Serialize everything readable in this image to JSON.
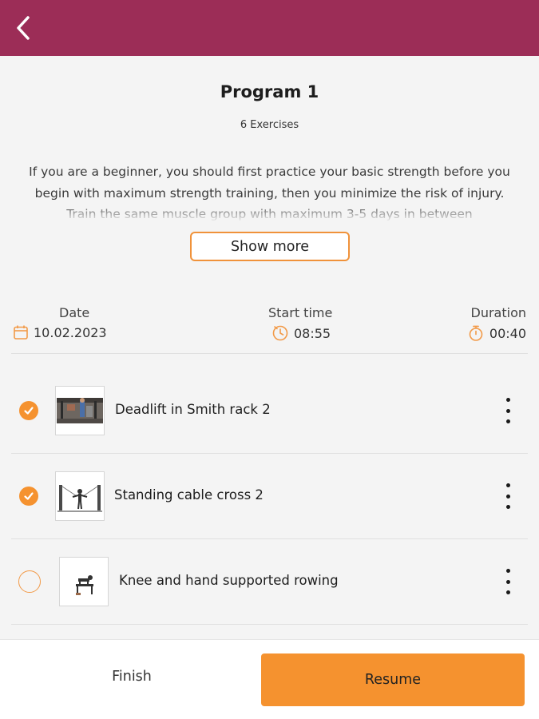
{
  "header": {
    "back_icon": "chevron-left-icon",
    "color": "#9c2d57"
  },
  "program": {
    "title": "Program 1",
    "exercise_count": "6 Exercises",
    "description": "If you are a beginner, you should first practice your basic strength before you begin with maximum strength training, then you minimize the risk of injury. Train the same muscle group with maximum 3-5 days in between",
    "show_more_label": "Show more"
  },
  "session": {
    "date_label": "Date",
    "date_value": "10.02.2023",
    "date_icon": "calendar-icon",
    "start_label": "Start time",
    "start_value": "08:55",
    "start_icon": "clock-icon",
    "duration_label": "Duration",
    "duration_value": "00:40",
    "duration_icon": "stopwatch-icon"
  },
  "exercises": [
    {
      "name": "Deadlift in Smith rack 2",
      "completed": true
    },
    {
      "name": "Standing cable cross 2",
      "completed": true
    },
    {
      "name": "Knee and hand supported rowing",
      "completed": false
    }
  ],
  "footer": {
    "finish_label": "Finish",
    "resume_label": "Resume"
  },
  "colors": {
    "accent": "#f5922f",
    "header": "#9c2d57"
  }
}
